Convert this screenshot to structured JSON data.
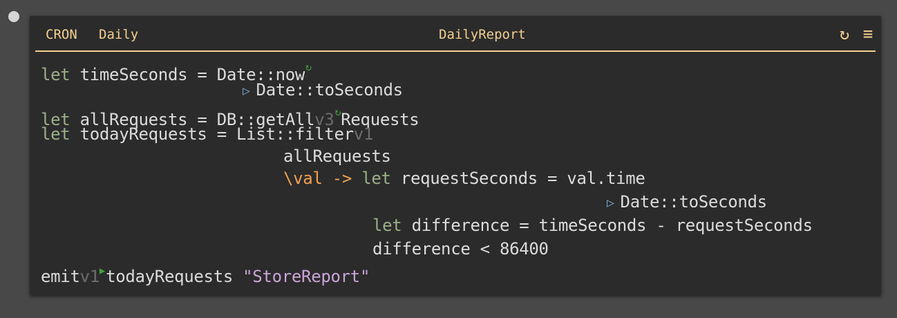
{
  "handler": {
    "module": "CRON",
    "modifier": "Daily",
    "name": "DailyReport",
    "icons": {
      "refresh": "refresh-icon",
      "menu": "hamburger-menu-icon"
    }
  },
  "code": {
    "kw_let": "let",
    "line1": {
      "var": " timeSeconds = ",
      "fn": "Date::now"
    },
    "line2": {
      "pipe_fn": "Date::toSeconds"
    },
    "line3": {
      "var": " allRequests = ",
      "fn": "DB::getAll",
      "version": "v3",
      "arg": "Requests"
    },
    "line4": {
      "var": " todayRequests = ",
      "fn": "List::filter",
      "version": "v1"
    },
    "line5": {
      "arg": "allRequests"
    },
    "line6": {
      "lambda": "\\val -> ",
      "rest": " requestSeconds = val.time"
    },
    "line7": {
      "pipe_fn": "Date::toSeconds"
    },
    "line8": {
      "rest": " difference = timeSeconds - requestSeconds"
    },
    "line9": {
      "expr": "difference < 86400"
    },
    "line10": {
      "fn": "emit",
      "version": "v1",
      "arg": "todayRequests ",
      "str": "\"StoreReport\""
    }
  },
  "colors": {
    "header": "#f4d08e",
    "keyword": "#9bb087",
    "lambda": "#f0a050",
    "string": "#c9a4d6",
    "version": "#6c6c6c",
    "pipe": "#7ea9d5",
    "live_value": "#3fa33f"
  }
}
